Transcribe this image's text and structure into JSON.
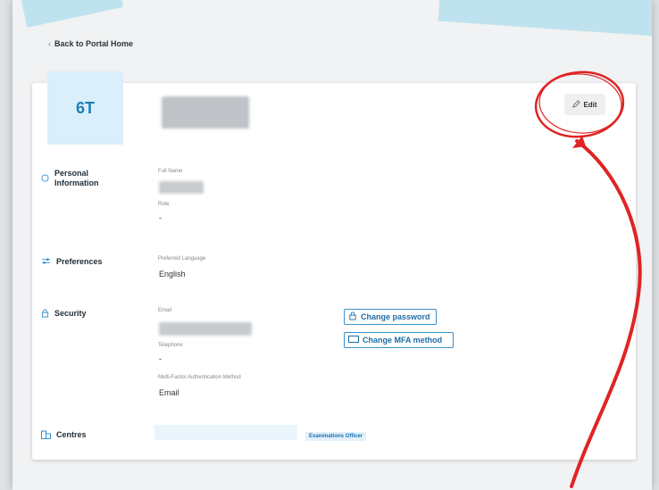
{
  "nav": {
    "back_label": "Back to Portal Home"
  },
  "profile": {
    "initials": "6T"
  },
  "actions": {
    "edit_label": "Edit"
  },
  "sections": {
    "personal": {
      "title_line1": "Personal",
      "title_line2": "Information",
      "full_name_label": "Full Name",
      "role_label": "Role",
      "role_value": "-"
    },
    "preferences": {
      "title": "Preferences",
      "language_label": "Preferred Language",
      "language_value": "English"
    },
    "security": {
      "title": "Security",
      "email_label": "Email",
      "telephone_label": "Telephone",
      "telephone_value": "-",
      "mfa_label": "Multi-Factor Authentication Method",
      "mfa_value": "Email",
      "change_password_label": "Change password",
      "change_mfa_label": "Change MFA method"
    },
    "centres": {
      "title": "Centres",
      "badge": "Examinations Officer"
    }
  },
  "colors": {
    "accent": "#1f6ca5",
    "annotation": "#e02424"
  },
  "icons": [
    "chevron-left-icon",
    "pencil-icon",
    "info-circle-icon",
    "sliders-icon",
    "lock-icon",
    "card-icon",
    "building-icon"
  ]
}
